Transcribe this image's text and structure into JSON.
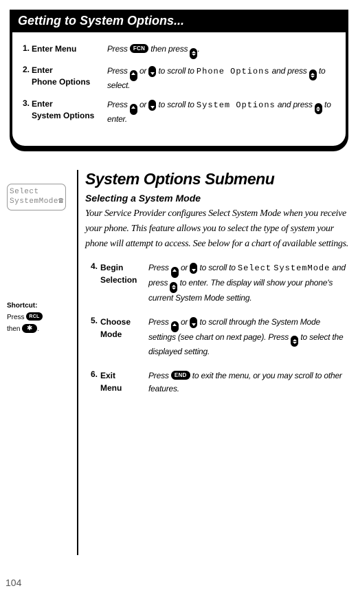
{
  "box": {
    "title": "Getting to System Options...",
    "steps": [
      {
        "num": "1.",
        "label": "Enter Menu",
        "desc_parts": [
          "Press ",
          "__FCN__",
          " then press ",
          "__UPDOWN__",
          "."
        ]
      },
      {
        "num": "2.",
        "label": "Enter\nPhone Options",
        "desc_parts": [
          "Press ",
          "__UP__",
          " or ",
          "__DOWN__",
          " to scroll to ",
          "__MENU:Phone Options__",
          " and press ",
          "__UPDOWN__",
          " to select."
        ]
      },
      {
        "num": "3.",
        "label": "Enter\nSystem Options",
        "desc_parts": [
          "Press ",
          "__UP__",
          " or ",
          "__DOWN__",
          " to scroll to ",
          "__MENU:System Options__",
          " and press ",
          "__UPDOWN__",
          " to enter."
        ]
      }
    ]
  },
  "lcd": {
    "line1": "Select",
    "line2": "SystemMode"
  },
  "shortcut": {
    "heading": "Shortcut:",
    "line1_a": "Press ",
    "rcl": "RCL",
    "line2_a": "then ",
    "star": "✱",
    "line2_b": "."
  },
  "main": {
    "heading": "System Options Submenu",
    "subheading": "Selecting a System Mode",
    "body": "Your Service Provider configures Select System Mode when you receive your phone. This feature allows you to select the type of system your phone will attempt to access. See below for a chart of available settings.",
    "steps": [
      {
        "num": "4.",
        "label": "Begin\nSelection",
        "desc_parts": [
          "Press ",
          "__UP__",
          " or ",
          "__DOWN__",
          " to scroll to ",
          "__MENU:Select__",
          " ",
          "__MENU:SystemMode__",
          " and press ",
          "__UPDOWN__",
          " to enter. The display will show your phone's current System Mode setting."
        ]
      },
      {
        "num": "5.",
        "label": "Choose\nMode",
        "desc_parts": [
          "Press ",
          "__UP__",
          " or ",
          "__DOWN__",
          " to scroll through the System Mode settings (see chart on next page). Press ",
          "__UPDOWN__",
          " to select the displayed setting."
        ]
      },
      {
        "num": "6.",
        "label": "Exit\nMenu",
        "desc_parts": [
          "Press ",
          "__END__",
          " to exit the menu, or you may scroll to other features."
        ]
      }
    ]
  },
  "page_num": "104"
}
